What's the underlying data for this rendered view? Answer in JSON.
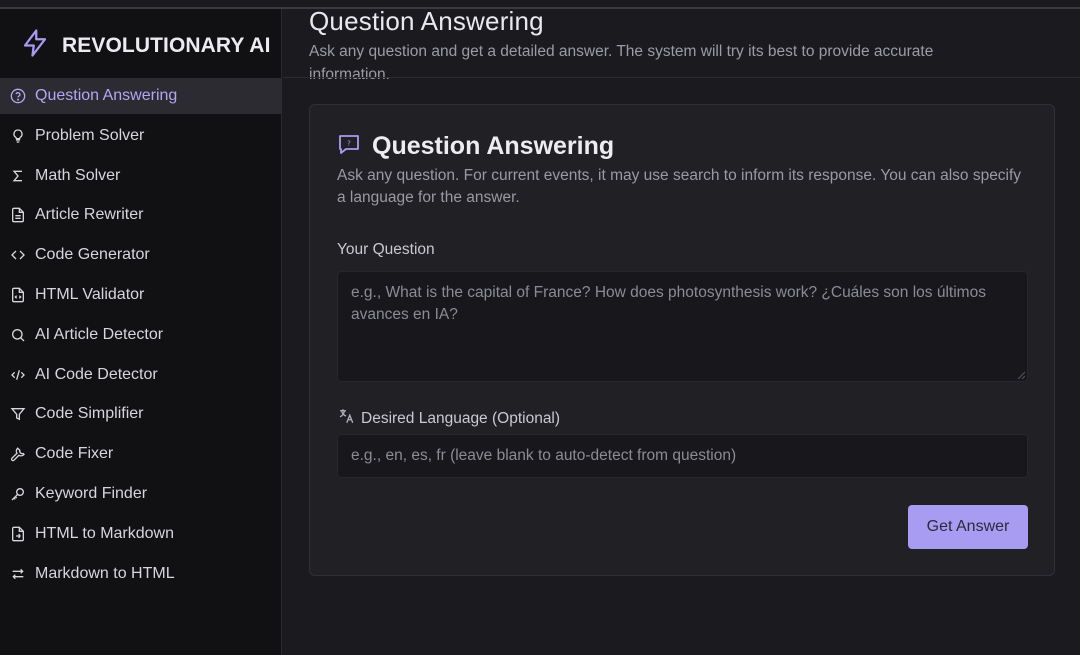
{
  "brand": {
    "name": "REVOLUTIONARY AI",
    "accent": "#a79cf2"
  },
  "sidebar": {
    "items": [
      {
        "label": "Question Answering",
        "icon": "help-circle-icon",
        "active": true
      },
      {
        "label": "Problem Solver",
        "icon": "lightbulb-icon"
      },
      {
        "label": "Math Solver",
        "icon": "sigma-icon"
      },
      {
        "label": "Article Rewriter",
        "icon": "document-icon"
      },
      {
        "label": "Code Generator",
        "icon": "code-brackets-icon"
      },
      {
        "label": "HTML Validator",
        "icon": "file-code-icon"
      },
      {
        "label": "AI Article Detector",
        "icon": "search-icon"
      },
      {
        "label": "AI Code Detector",
        "icon": "code-slash-icon"
      },
      {
        "label": "Code Simplifier",
        "icon": "filter-icon"
      },
      {
        "label": "Code Fixer",
        "icon": "wrench-icon"
      },
      {
        "label": "Keyword Finder",
        "icon": "key-icon"
      },
      {
        "label": "HTML to Markdown",
        "icon": "file-convert-icon"
      },
      {
        "label": "Markdown to HTML",
        "icon": "arrows-swap-icon"
      }
    ]
  },
  "header": {
    "title": "Question Answering",
    "subtitle": "Ask any question and get a detailed answer. The system will try its best to provide accurate information."
  },
  "card": {
    "title": "Question Answering",
    "description": "Ask any question. For current events, it may use search to inform its response. You can also specify a language for the answer.",
    "question_label": "Your Question",
    "question_placeholder": "e.g., What is the capital of France? How does photosynthesis work? ¿Cuáles son los últimos avances en IA?",
    "language_label": "Desired Language (Optional)",
    "language_placeholder": "e.g., en, es, fr (leave blank to auto-detect from question)",
    "submit_label": "Get Answer"
  }
}
